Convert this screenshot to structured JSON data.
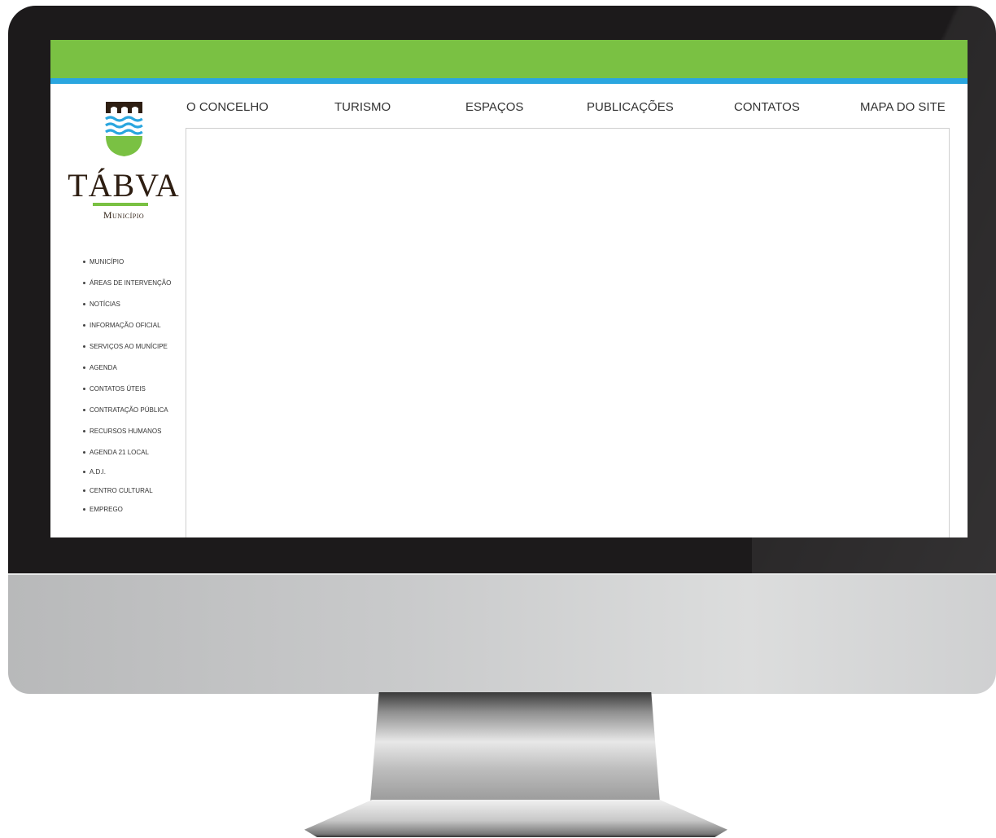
{
  "brand": {
    "name": "TÁBVA",
    "subtitle": "Município",
    "colors": {
      "green": "#7ac143",
      "blue": "#2aa6df",
      "brown": "#2e1e12"
    }
  },
  "topnav": [
    {
      "label": "O CONCELHO"
    },
    {
      "label": "TURISMO"
    },
    {
      "label": "ESPAÇOS"
    },
    {
      "label": "PUBLICAÇÕES"
    },
    {
      "label": "CONTATOS"
    },
    {
      "label": "MAPA DO SITE"
    }
  ],
  "sidemenu": [
    {
      "label": "MUNICÍPIO"
    },
    {
      "label": "ÁREAS DE INTERVENÇÃO"
    },
    {
      "label": "NOTÍCIAS"
    },
    {
      "label": "INFORMAÇÃO OFICIAL"
    },
    {
      "label": "SERVIÇOS AO MUNÍCIPE"
    },
    {
      "label": "AGENDA"
    },
    {
      "label": "CONTATOS ÚTEIS"
    },
    {
      "label": "CONTRATAÇÃO PÚBLICA"
    },
    {
      "label": "RECURSOS HUMANOS"
    },
    {
      "label": "AGENDA 21 LOCAL"
    },
    {
      "label": "A.D.I."
    },
    {
      "label": "CENTRO CULTURAL"
    },
    {
      "label": "EMPREGO"
    }
  ]
}
